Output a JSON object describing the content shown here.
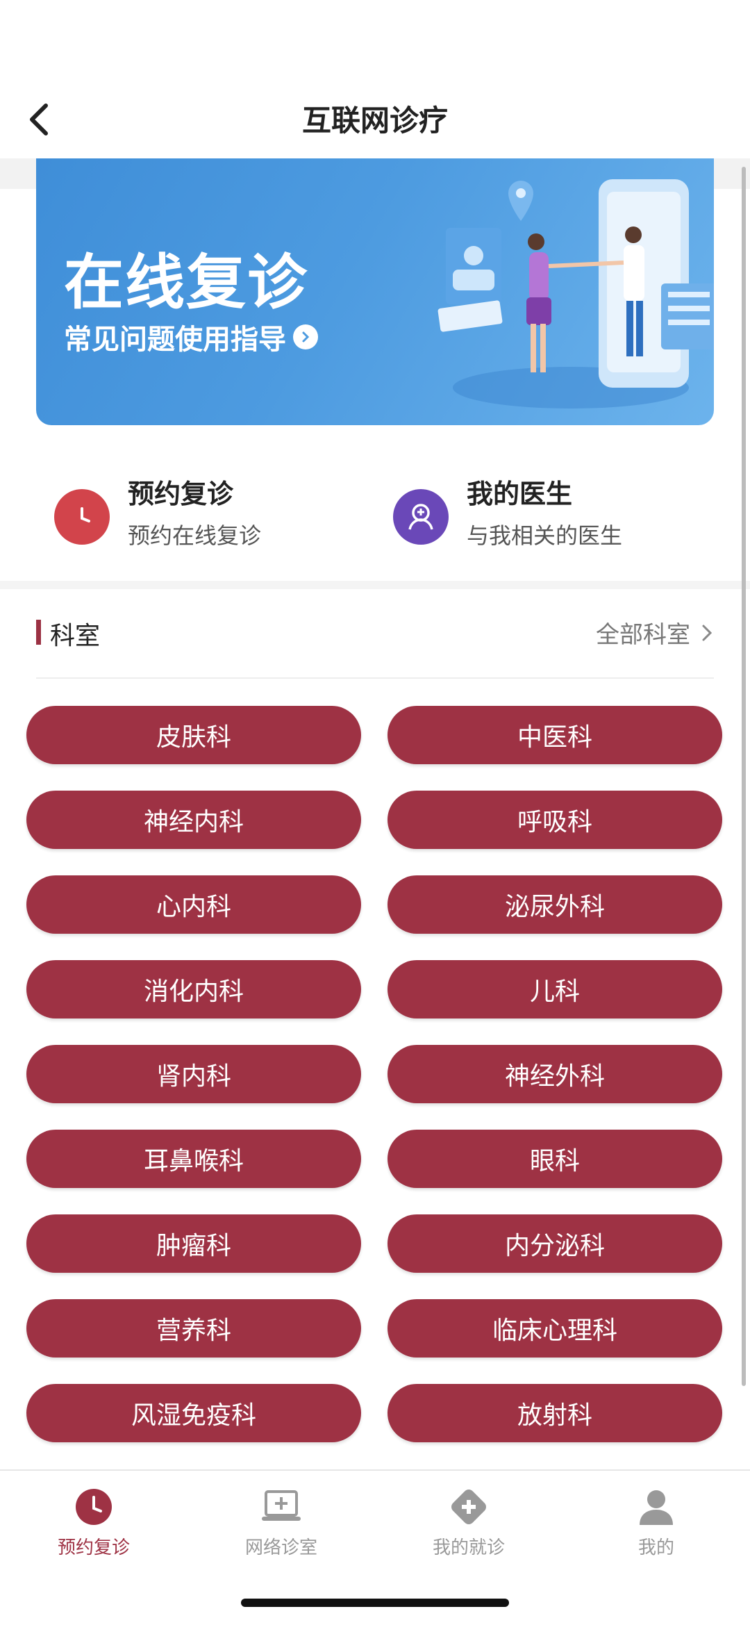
{
  "nav": {
    "title": "互联网诊疗"
  },
  "banner": {
    "title": "在线复诊",
    "subtitle": "常见问题使用指导"
  },
  "quick_actions": [
    {
      "title": "预约复诊",
      "subtitle": "预约在线复诊",
      "icon": "clock-icon",
      "color": "#d2444b"
    },
    {
      "title": "我的医生",
      "subtitle": "与我相关的医生",
      "icon": "doctor-icon",
      "color": "#6a48b8"
    }
  ],
  "departments": {
    "title": "科室",
    "all_label": "全部科室",
    "items": [
      "皮肤科",
      "中医科",
      "神经内科",
      "呼吸科",
      "心内科",
      "泌尿外科",
      "消化内科",
      "儿科",
      "肾内科",
      "神经外科",
      "耳鼻喉科",
      "眼科",
      "肿瘤科",
      "内分泌科",
      "营养科",
      "临床心理科",
      "风湿免疫科",
      "放射科"
    ]
  },
  "tabbar": {
    "items": [
      {
        "label": "预约复诊",
        "icon": "clock-icon",
        "active": true
      },
      {
        "label": "网络诊室",
        "icon": "laptop-plus-icon",
        "active": false
      },
      {
        "label": "我的就诊",
        "icon": "medical-cross-icon",
        "active": false
      },
      {
        "label": "我的",
        "icon": "user-icon",
        "active": false
      }
    ]
  },
  "colors": {
    "accent": "#9e3244",
    "banner": "#4d9be0"
  }
}
